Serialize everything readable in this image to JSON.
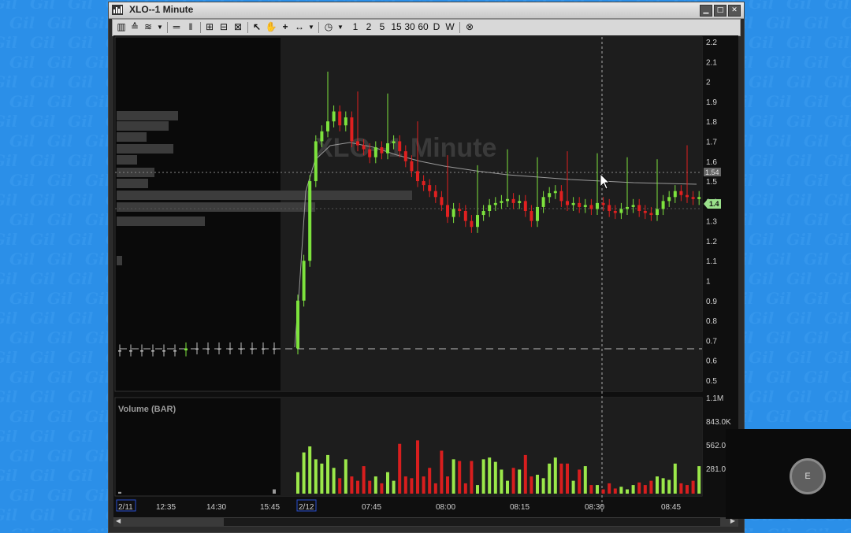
{
  "window": {
    "title": "XLO--1 Minute",
    "controls": [
      "minimize",
      "maximize",
      "close"
    ]
  },
  "toolbar": {
    "timeframes": [
      "1",
      "2",
      "5",
      "15",
      "30",
      "60",
      "D",
      "W"
    ],
    "tools": [
      "bar-chart-icon",
      "candle-icon",
      "line-type-icon",
      "dropdown-icon",
      "horizontal-lines-icon",
      "vertical-lines-icon",
      "layout-1-icon",
      "layout-2-icon",
      "layout-3-icon",
      "arrow-cursor-icon",
      "hand-icon",
      "crosshair-icon",
      "measure-icon",
      "dropdown-icon",
      "clock-icon",
      "dropdown-icon",
      "cancel-icon"
    ]
  },
  "chart": {
    "watermark": "XLO--1 Minute",
    "price_ticks": [
      "2.2",
      "2.1",
      "2",
      "1.9",
      "1.8",
      "1.7",
      "1.6",
      "1.5",
      "1.4",
      "1.3",
      "1.2",
      "1.1",
      "1",
      "0.9",
      "0.8",
      "0.7",
      "0.6",
      "0.5"
    ],
    "price_marker_upper": "1.54",
    "price_marker_last": "1.4",
    "volume_label": "Volume (BAR)",
    "volume_ticks": [
      "1.1M",
      "843.0K",
      "562.0",
      "281.0"
    ],
    "time_labels": [
      "2/11",
      "12:35",
      "14:30",
      "15:45",
      "2/12",
      "07:45",
      "08:00",
      "08:15",
      "08:30",
      "08:45"
    ]
  },
  "chart_data": {
    "type": "candlestick",
    "title": "XLO--1 Minute",
    "ylim": [
      0.5,
      2.2
    ],
    "close_series": [
      0.65,
      0.65,
      0.65,
      0.65,
      0.65,
      0.65,
      0.66,
      0.66,
      0.66,
      0.66,
      0.66,
      0.66,
      0.66,
      0.66,
      0.66,
      0.9,
      1.1,
      1.5,
      1.7,
      1.75,
      1.8,
      1.85,
      1.78,
      1.82,
      1.7,
      1.68,
      1.66,
      1.62,
      1.67,
      1.64,
      1.69,
      1.7,
      1.65,
      1.6,
      1.55,
      1.5,
      1.48,
      1.45,
      1.42,
      1.38,
      1.32,
      1.36,
      1.35,
      1.3,
      1.27,
      1.33,
      1.35,
      1.38,
      1.39,
      1.4,
      1.41,
      1.39,
      1.4,
      1.35,
      1.3,
      1.37,
      1.42,
      1.44,
      1.45,
      1.4,
      1.38,
      1.39,
      1.37,
      1.38,
      1.36,
      1.39,
      1.38,
      1.35,
      1.34,
      1.36,
      1.37,
      1.38,
      1.35,
      1.34,
      1.33,
      1.36,
      1.4,
      1.42,
      1.45,
      1.43,
      1.42,
      1.41,
      1.42
    ],
    "volume_series": [
      0.02,
      0,
      0,
      0,
      0,
      0,
      0,
      0,
      0,
      0,
      0,
      0,
      0,
      0,
      0.05,
      0.25,
      0.48,
      0.55,
      0.4,
      0.35,
      0.45,
      0.3,
      0.18,
      0.4,
      0.2,
      0.15,
      0.32,
      0.15,
      0.2,
      0.12,
      0.25,
      0.15,
      0.58,
      0.2,
      0.18,
      0.62,
      0.2,
      0.3,
      0.12,
      0.5,
      0.2,
      0.4,
      0.38,
      0.12,
      0.38,
      0.1,
      0.4,
      0.42,
      0.37,
      0.28,
      0.15,
      0.3,
      0.28,
      0.45,
      0.2,
      0.22,
      0.18,
      0.35,
      0.42,
      0.35,
      0.35,
      0.15,
      0.28,
      0.32,
      0.1,
      0.1,
      0.05,
      0.12,
      0.06,
      0.08,
      0.05,
      0.1,
      0.13,
      0.1,
      0.15,
      0.2,
      0.18,
      0.16,
      0.35,
      0.12,
      0.1,
      0.15,
      0.32
    ],
    "volume_ylim": [
      0,
      1.1
    ]
  },
  "overlay": {
    "avatar_initial": "E"
  }
}
